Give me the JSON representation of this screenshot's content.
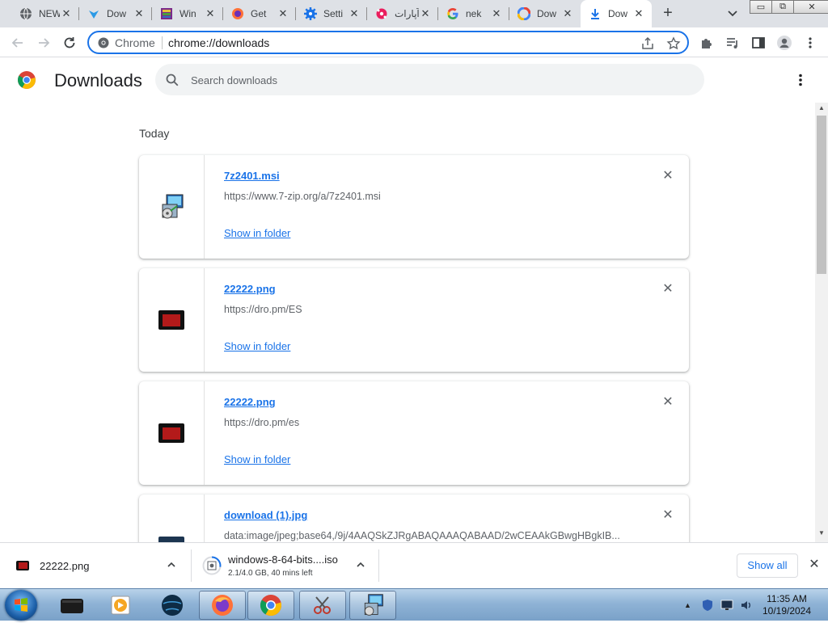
{
  "tabs": [
    {
      "title": "NEW",
      "icon": "globe-icon",
      "active": false
    },
    {
      "title": "Dow",
      "icon": "download-site-icon",
      "active": false
    },
    {
      "title": "Win",
      "icon": "winrar-icon",
      "active": false
    },
    {
      "title": "Get",
      "icon": "firefox-icon",
      "active": false
    },
    {
      "title": "Setti",
      "icon": "settings-gear-icon",
      "active": false
    },
    {
      "title": "آپارات",
      "icon": "aparat-icon",
      "active": false
    },
    {
      "title": "nek",
      "icon": "google-icon",
      "active": false
    },
    {
      "title": "Dow",
      "icon": "colorful-circle-icon",
      "active": false
    },
    {
      "title": "Dow",
      "icon": "download-arrow-icon",
      "active": true
    }
  ],
  "new_tab_label": "+",
  "window_buttons": {
    "minimize": "▭",
    "maximize": "⧉",
    "close": "✕"
  },
  "omnibox": {
    "scheme_label": "Chrome",
    "url": "chrome://downloads"
  },
  "page": {
    "title": "Downloads",
    "search_placeholder": "Search downloads",
    "section_label": "Today"
  },
  "downloads": [
    {
      "file": "7z2401.msi",
      "url": "https://www.7-zip.org/a/7z2401.msi",
      "action": "Show in folder",
      "icon": "installer-icon"
    },
    {
      "file": "22222.png",
      "url": "https://dro.pm/ES",
      "action": "Show in folder",
      "icon": "red-image-icon"
    },
    {
      "file": "22222.png",
      "url": "https://dro.pm/es",
      "action": "Show in folder",
      "icon": "red-image-icon"
    },
    {
      "file": "download (1).jpg",
      "url": "data:image/jpeg;base64,/9j/4AAQSkZJRgABAQAAAQABAAD/2wCEAAkGBwgHBgkIB...",
      "action": "",
      "icon": "image-icon"
    }
  ],
  "shelf": {
    "items": [
      {
        "name": "22222.png",
        "status": ""
      },
      {
        "name": "windows-8-64-bits....iso",
        "status": "2.1/4.0 GB, 40 mins left"
      }
    ],
    "show_all_label": "Show all"
  },
  "taskbar": {
    "apps": [
      "media-app-icon",
      "vlc-like-player-icon",
      "dark-globe-icon",
      "firefox-icon",
      "chrome-icon",
      "snipping-tool-icon",
      "installer-icon"
    ],
    "time": "11:35 AM",
    "date": "10/19/2024"
  },
  "colors": {
    "accent": "#1a73e8",
    "tabstrip": "#dee1e6"
  }
}
